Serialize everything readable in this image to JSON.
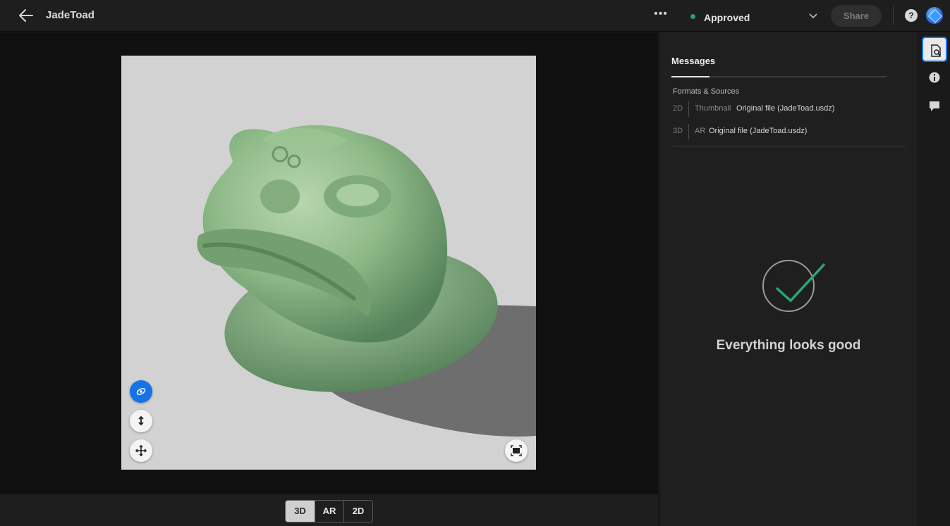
{
  "header": {
    "back_icon": "arrow-left-icon",
    "title": "JadeToad",
    "more_icon": "more-horizontal-icon",
    "status": {
      "label": "Approved",
      "color": "#2d9d78"
    },
    "share_label": "Share",
    "help_icon": "help-icon",
    "app_icon": "app-switcher-icon"
  },
  "viewer": {
    "controls": [
      {
        "name": "orbit-control",
        "icon": "orbit-icon",
        "active": true
      },
      {
        "name": "dolly-control",
        "icon": "dolly-icon",
        "active": false
      },
      {
        "name": "pan-control",
        "icon": "pan-icon",
        "active": false
      }
    ],
    "fit_icon": "fit-to-screen-icon",
    "model": "jade-toad-3d-model"
  },
  "view_modes": {
    "selected": "3D",
    "options": [
      "3D",
      "AR",
      "2D"
    ]
  },
  "panel": {
    "tab": "Messages",
    "section_title": "Formats & Sources",
    "rows": [
      {
        "kind": "2D",
        "type": "Thumbnail",
        "source": "Original file (JadeToad.usdz)"
      },
      {
        "kind": "3D",
        "type": "AR",
        "source": "Original file (JadeToad.usdz)"
      }
    ],
    "status_message": "Everything looks good",
    "status_icon": "checkmark-circle-icon",
    "accent": "#2ea670"
  },
  "rail": [
    {
      "name": "rail-file-inspect",
      "icon": "file-search-icon",
      "selected": true
    },
    {
      "name": "rail-info",
      "icon": "info-icon",
      "selected": false
    },
    {
      "name": "rail-comments",
      "icon": "comment-icon",
      "selected": false
    }
  ]
}
